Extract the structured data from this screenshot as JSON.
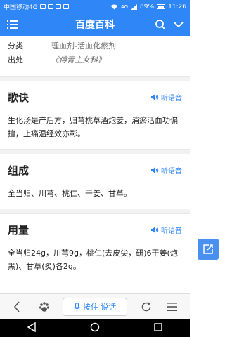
{
  "status": {
    "carrier": "中国移动4G",
    "signal": "4G",
    "battery": "89%",
    "time": "11:26"
  },
  "header": {
    "title": "百度百科"
  },
  "info": [
    {
      "key": "分类",
      "value": "理血剂-活血化瘀剂"
    },
    {
      "key": "出处",
      "value": "《傅青主女科》"
    }
  ],
  "sections": [
    {
      "title": "歌诀",
      "listen": "听语音",
      "body": "生化汤是产后方，归芎桃草酒炮姜，消瘀活血功偏擅，止痛温经效亦彰。"
    },
    {
      "title": "组成",
      "listen": "听语音",
      "body": "全当归、川芎、桃仁、干姜、甘草。"
    },
    {
      "title": "用量",
      "listen": "听语音",
      "body": "全当归24g，川芎9g，桃仁(去皮尖，研)6干姜(炮黑)、甘草(炙)各2g。"
    }
  ],
  "bottom": {
    "voice_label": "按住 说话"
  },
  "colors": {
    "accent": "#2f86f6"
  }
}
